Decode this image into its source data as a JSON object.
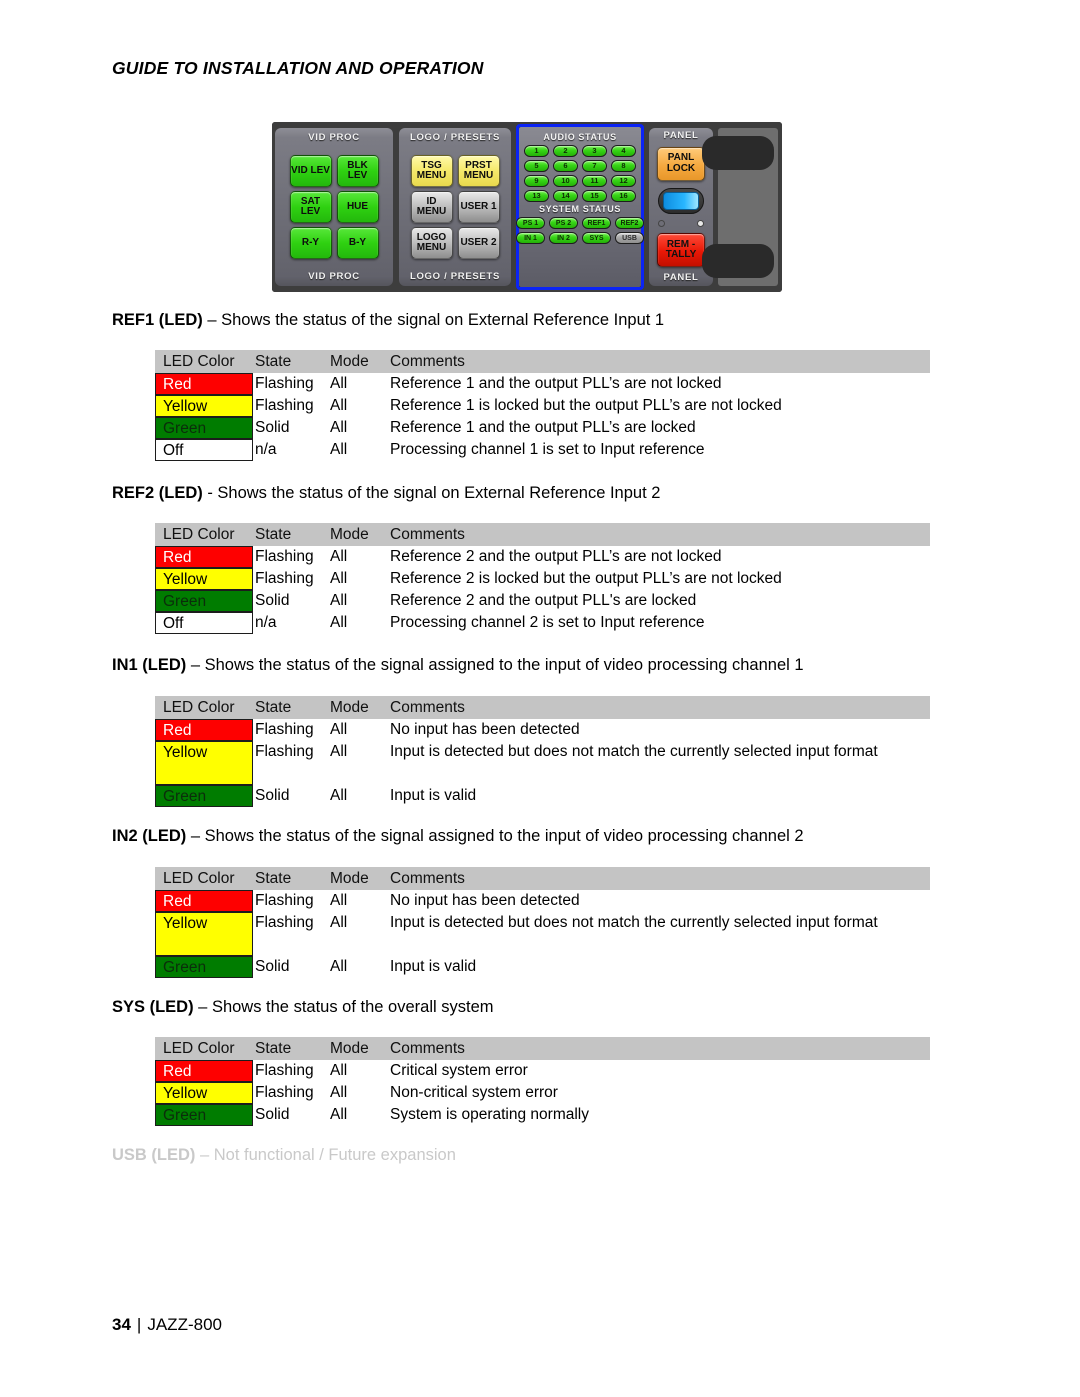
{
  "header": {
    "title": "GUIDE TO INSTALLATION AND OPERATION"
  },
  "panel_image": {
    "groups": [
      {
        "name": "vid-proc",
        "top_label": "VID PROC",
        "bottom_label": "VID PROC",
        "buttons": [
          {
            "label": "VID LEV",
            "color": "green"
          },
          {
            "label": "BLK LEV",
            "color": "green"
          },
          {
            "label": "SAT LEV",
            "color": "green"
          },
          {
            "label": "HUE",
            "color": "green"
          },
          {
            "label": "R-Y",
            "color": "green"
          },
          {
            "label": "B-Y",
            "color": "green"
          }
        ]
      },
      {
        "name": "logo-presets",
        "top_label": "LOGO / PRESETS",
        "bottom_label": "LOGO / PRESETS",
        "buttons": [
          {
            "label": "TSG MENU",
            "color": "yellow"
          },
          {
            "label": "PRST MENU",
            "color": "yellow"
          },
          {
            "label": "ID MENU",
            "color": "gray"
          },
          {
            "label": "USER 1",
            "color": "gray"
          },
          {
            "label": "LOGO MENU",
            "color": "gray"
          },
          {
            "label": "USER 2",
            "color": "gray"
          }
        ]
      },
      {
        "name": "audio-status",
        "audio_title": "AUDIO STATUS",
        "audio_leds": [
          "1",
          "2",
          "3",
          "4",
          "5",
          "6",
          "7",
          "8",
          "9",
          "10",
          "11",
          "12",
          "13",
          "14",
          "15",
          "16"
        ],
        "system_title": "SYSTEM STATUS",
        "system_leds": [
          {
            "label": "PS 1",
            "state": "on"
          },
          {
            "label": "PS 2",
            "state": "on"
          },
          {
            "label": "REF1",
            "state": "on"
          },
          {
            "label": "REF2",
            "state": "on"
          },
          {
            "label": "IN 1",
            "state": "on"
          },
          {
            "label": "IN 2",
            "state": "on"
          },
          {
            "label": "SYS",
            "state": "on"
          },
          {
            "label": "USB",
            "state": "off"
          }
        ],
        "highlight_color": "#0b24f5"
      },
      {
        "name": "panel",
        "top_label": "PANEL",
        "bottom_label": "PANEL",
        "buttons": [
          {
            "label": "PANL LOCK",
            "color": "orange"
          },
          {
            "label": "REM - TALLY",
            "color": "red"
          }
        ]
      }
    ]
  },
  "table_headers": [
    "LED Color",
    "State",
    "Mode",
    "Comments"
  ],
  "sections": [
    {
      "id": "ref1",
      "heading_bold": "REF1 (LED)",
      "heading_rest": " – Shows the status of the signal on External Reference Input 1",
      "rows": [
        {
          "color": "Red",
          "swatch": "red",
          "state": "Flashing",
          "mode": "All",
          "comment": "Reference 1 and the output PLL’s are not locked"
        },
        {
          "color": "Yellow",
          "swatch": "yellow",
          "state": "Flashing",
          "mode": "All",
          "comment": "Reference 1 is locked but the output PLL’s are not locked"
        },
        {
          "color": "Green",
          "swatch": "green",
          "state": "Solid",
          "mode": "All",
          "comment": "Reference 1 and the output PLL’s are locked"
        },
        {
          "color": "Off",
          "swatch": "white",
          "state": "n/a",
          "mode": "All",
          "comment": "Processing channel 1 is set to Input reference"
        }
      ]
    },
    {
      "id": "ref2",
      "heading_bold": "REF2 (LED)",
      "heading_rest": " - Shows the status of the signal on External Reference Input 2",
      "rows": [
        {
          "color": "Red",
          "swatch": "red",
          "state": "Flashing",
          "mode": "All",
          "comment": "Reference 2 and the output PLL’s are not locked"
        },
        {
          "color": "Yellow",
          "swatch": "yellow",
          "state": "Flashing",
          "mode": "All",
          "comment": "Reference 2 is locked but the output PLL’s are not locked"
        },
        {
          "color": "Green",
          "swatch": "green",
          "state": "Solid",
          "mode": "All",
          "comment": "Reference 2 and the output PLL's are locked"
        },
        {
          "color": "Off",
          "swatch": "white",
          "state": "n/a",
          "mode": "All",
          "comment": "Processing channel 2 is set to Input reference"
        }
      ]
    },
    {
      "id": "in1",
      "heading_bold": "IN1 (LED)",
      "heading_rest": " – Shows the status of the signal assigned to the input of video processing channel 1",
      "rows": [
        {
          "color": "Red",
          "swatch": "red",
          "state": "Flashing",
          "mode": "All",
          "comment": "No input has been detected"
        },
        {
          "color": "Yellow",
          "swatch": "yellow",
          "state": "Flashing",
          "mode": "All",
          "comment": "Input is detected but does not match the currently selected input format",
          "tall": true
        },
        {
          "color": "Green",
          "swatch": "green",
          "state": "Solid",
          "mode": "All",
          "comment": "Input is valid"
        }
      ]
    },
    {
      "id": "in2",
      "heading_bold": "IN2 (LED)",
      "heading_rest": " – Shows the status of the signal assigned to the input of video processing channel 2",
      "rows": [
        {
          "color": "Red",
          "swatch": "red",
          "state": "Flashing",
          "mode": "All",
          "comment": "No input has been detected"
        },
        {
          "color": "Yellow",
          "swatch": "yellow",
          "state": "Flashing",
          "mode": "All",
          "comment": "Input is detected but does not match the currently selected input format",
          "tall": true
        },
        {
          "color": "Green",
          "swatch": "green",
          "state": "Solid",
          "mode": "All",
          "comment": "Input is valid"
        }
      ]
    },
    {
      "id": "sys",
      "heading_bold": "SYS (LED)",
      "heading_rest": " – Shows the status of the overall system",
      "rows": [
        {
          "color": "Red",
          "swatch": "red",
          "state": "Flashing",
          "mode": "All",
          "comment": "Critical system error"
        },
        {
          "color": "Yellow",
          "swatch": "yellow",
          "state": "Flashing",
          "mode": "All",
          "comment": "Non-critical system error"
        },
        {
          "color": "Green",
          "swatch": "green",
          "state": "Solid",
          "mode": "All",
          "comment": "System is operating normally"
        }
      ]
    }
  ],
  "usb_note": {
    "bold": "USB (LED)",
    "rest": " – Not functional / Future expansion"
  },
  "footer": {
    "page_number": "34",
    "separator": "|",
    "product": "JAZZ-800"
  }
}
